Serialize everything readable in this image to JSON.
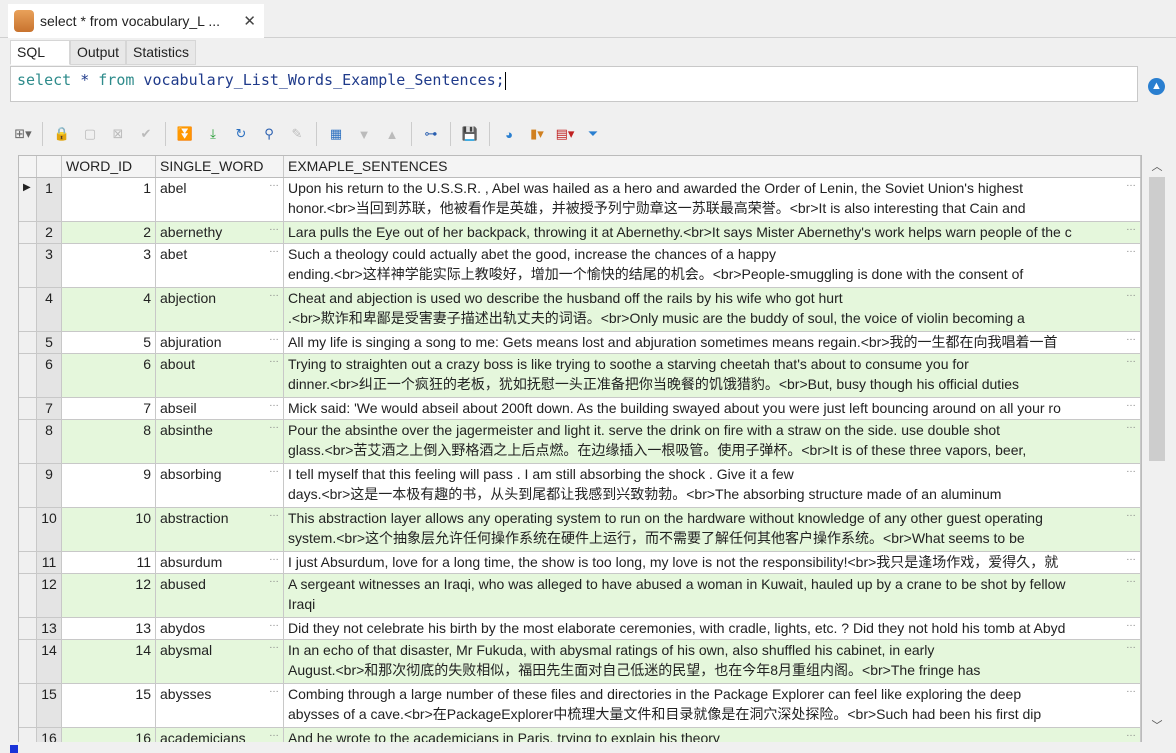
{
  "tab": {
    "title": "select * from vocabulary_L ...",
    "close": "✕"
  },
  "subtabs": [
    "SQL",
    "Output",
    "Statistics"
  ],
  "editor": {
    "kw1": "select",
    "star": " * ",
    "kw2": "from",
    "rest": " vocabulary_List_Words_Example_Sentences;"
  },
  "columns": [
    "WORD_ID",
    "SINGLE_WORD",
    "EXMAPLE_SENTENCES"
  ],
  "rows": [
    {
      "n": "1",
      "id": "1",
      "word": "abel",
      "lines": [
        "Upon his return to the U.S.S.R. , Abel was hailed as a hero and awarded the Order of Lenin, the Soviet Union's highest",
        "honor.<br>当回到苏联，他被看作是英雄，并被授予列宁勋章这一苏联最高荣誉。<br>It is also interesting that Cain and"
      ]
    },
    {
      "n": "2",
      "id": "2",
      "word": "abernethy",
      "lines": [
        "Lara pulls the Eye out of her backpack, throwing it at Abernethy.<br>It says Mister Abernethy's work helps warn people of the c"
      ]
    },
    {
      "n": "3",
      "id": "3",
      "word": "abet",
      "lines": [
        "Such a theology could actually abet the good, increase the chances of a happy",
        "ending.<br>这样神学能实际上教唆好，增加一个愉快的结尾的机会。<br>People-smuggling is done with the consent of"
      ]
    },
    {
      "n": "4",
      "id": "4",
      "word": "abjection",
      "lines": [
        "Cheat and abjection is used wo describe the husband off the rails by his wife who got hurt",
        ".<br>欺诈和卑鄙是受害妻子描述出轨丈夫的词语。<br>Only music are the buddy of soul, the voice of violin becoming a"
      ]
    },
    {
      "n": "5",
      "id": "5",
      "word": "abjuration",
      "lines": [
        "All my life is singing a song to me: Gets means lost and abjuration sometimes means regain.<br>我的一生都在向我唱着一首"
      ]
    },
    {
      "n": "6",
      "id": "6",
      "word": "about",
      "lines": [
        "Trying to straighten out a crazy boss is like trying to soothe a starving cheetah that's about to consume you for",
        "dinner.<br>纠正一个疯狂的老板，犹如抚慰一头正准备把你当晚餐的饥饿猎豹。<br>But, busy though his official duties"
      ]
    },
    {
      "n": "7",
      "id": "7",
      "word": "abseil",
      "lines": [
        "Mick said: 'We would abseil about 200ft down. As the building swayed about you were just left bouncing around on all your ro"
      ]
    },
    {
      "n": "8",
      "id": "8",
      "word": "absinthe",
      "lines": [
        "Pour the absinthe over the jagermeister and light it. serve the drink on fire with a straw on the side. use double shot",
        "glass.<br>苦艾酒之上倒入野格酒之上后点燃。在边缘插入一根吸管。使用子弹杯。<br>It is of these three vapors, beer,"
      ]
    },
    {
      "n": "9",
      "id": "9",
      "word": "absorbing",
      "lines": [
        "I tell myself that this feeling will pass . I am still absorbing the shock . Give it a few",
        "days.<br>这是一本极有趣的书，从头到尾都让我感到兴致勃勃。<br>The absorbing structure made of an aluminum"
      ]
    },
    {
      "n": "10",
      "id": "10",
      "word": "abstraction",
      "lines": [
        "This abstraction layer allows any operating system to run on the hardware without knowledge of any other guest operating",
        "system.<br>这个抽象层允许任何操作系统在硬件上运行，而不需要了解任何其他客户操作系统。<br>What seems to be"
      ]
    },
    {
      "n": "11",
      "id": "11",
      "word": "absurdum",
      "lines": [
        "I just Absurdum, love for a long time, the show is too long, my love is not the responsibility!<br>我只是逢场作戏，爱得久，就"
      ]
    },
    {
      "n": "12",
      "id": "12",
      "word": "abused",
      "lines": [
        "A sergeant witnesses an Iraqi, who was alleged to have abused a woman in Kuwait, hauled up by a crane to be shot by fellow",
        "Iraqi"
      ]
    },
    {
      "n": "13",
      "id": "13",
      "word": "abydos",
      "lines": [
        "Did they not celebrate his birth by the most elaborate ceremonies, with cradle, lights, etc. ? Did they not hold his tomb at Abyd"
      ]
    },
    {
      "n": "14",
      "id": "14",
      "word": "abysmal",
      "lines": [
        "In an echo of that disaster, Mr Fukuda, with abysmal ratings of his own, also shuffled his cabinet, in early",
        "August.<br>和那次彻底的失败相似，福田先生面对自己低迷的民望，也在今年8月重组内阁。<br>The fringe has"
      ]
    },
    {
      "n": "15",
      "id": "15",
      "word": "abysses",
      "lines": [
        "Combing through a large number of these files and directories in the Package Explorer can feel like exploring the deep",
        "abysses of a cave.<br>在PackageExplorer中梳理大量文件和目录就像是在洞穴深处探险。<br>Such had been his first dip"
      ]
    },
    {
      "n": "16",
      "id": "16",
      "word": "academicians",
      "lines": [
        "And he wrote to the academicians in Paris, trying to explain his theory"
      ]
    }
  ]
}
